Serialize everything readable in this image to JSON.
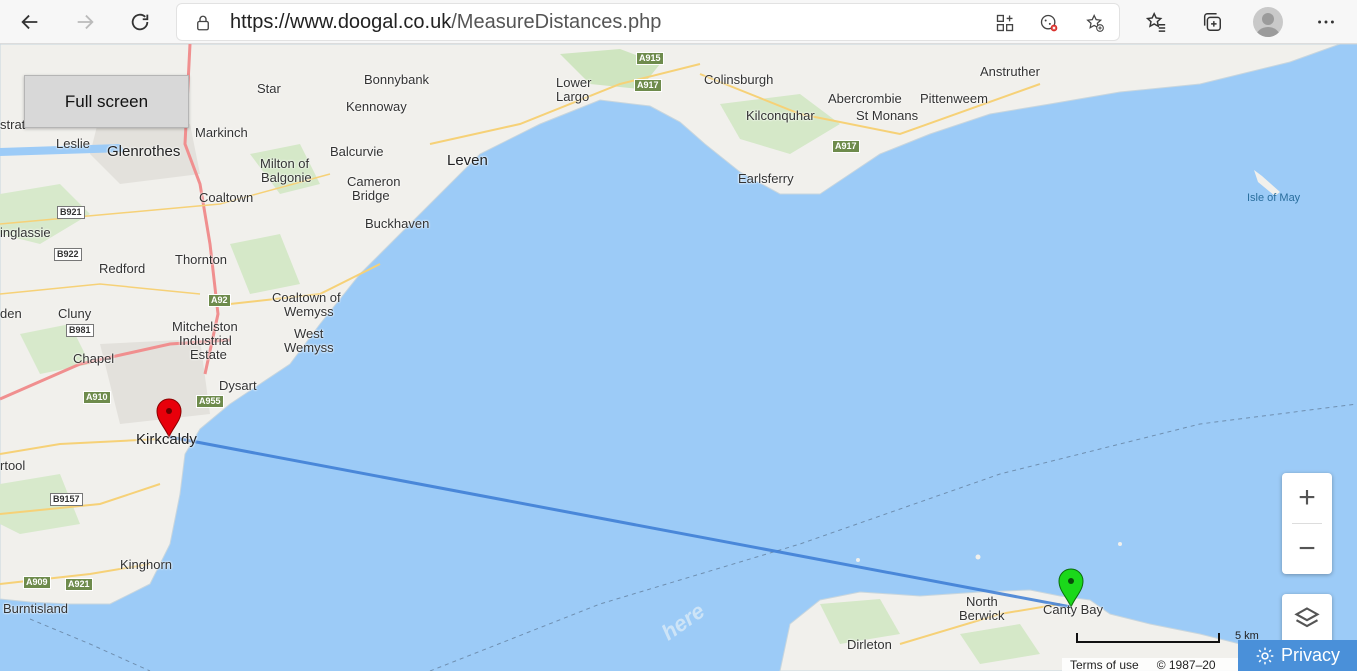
{
  "browser": {
    "url_host": "https://www.doogal.co.uk",
    "url_path": "/MeasureDistances.php"
  },
  "map": {
    "fullscreen_label": "Full screen",
    "zoom_in": "+",
    "zoom_out": "−",
    "scale_label": "5 km",
    "watermark": "here",
    "attribution": {
      "terms": "Terms of use",
      "copyright": "© 1987–20"
    },
    "privacy_label": "Privacy",
    "places": {
      "bonnybank": "Bonnybank",
      "star": "Star",
      "kennoway": "Kennoway",
      "lower_largo_1": "Lower",
      "lower_largo_2": "Largo",
      "colinsburgh": "Colinsburgh",
      "anstruther": "Anstruther",
      "kilconquhar": "Kilconquhar",
      "abercrombie": "Abercrombie",
      "pittenweem": "Pittenweem",
      "st_monans": "St Monans",
      "markinch": "Markinch",
      "leslie": "Leslie",
      "glenrothes": "Glenrothes",
      "milton_1": "Milton of",
      "milton_2": "Balgonie",
      "balcurvie": "Balcurvie",
      "leven": "Leven",
      "cameron_1": "Cameron",
      "cameron_2": "Bridge",
      "earlsferry": "Earlsferry",
      "coaltown": "Coaltown",
      "isle_of_may": "Isle of May",
      "buckhaven": "Buckhaven",
      "inglassie": "inglassie",
      "thornton": "Thornton",
      "redford": "Redford",
      "coaltown_wemyss_1": "Coaltown of",
      "coaltown_wemyss_2": "Wemyss",
      "west_wemyss_1": "West",
      "west_wemyss_2": "Wemyss",
      "cluny": "Cluny",
      "den": "den",
      "mitchelston_1": "Mitchelston",
      "mitchelston_2": "Industrial",
      "mitchelston_3": "Estate",
      "chapel": "Chapel",
      "dysart": "Dysart",
      "kirkcaldy": "Kirkcaldy",
      "rtool": "rtool",
      "kinghorn": "Kinghorn",
      "burntisland": "Burntisland",
      "strat": "strat",
      "north_berwick_1": "North",
      "north_berwick_2": "Berwick",
      "canty_bay": "Canty Bay",
      "dirleton": "Dirleton"
    },
    "roads": {
      "a915": "A915",
      "a917a": "A917",
      "a917b": "A917",
      "b921": "B921",
      "b922": "B922",
      "a92": "A92",
      "b981": "B981",
      "a910": "A910",
      "a955": "A955",
      "b9157": "B9157",
      "a909": "A909",
      "a921": "A921"
    },
    "markers": {
      "start_color": "#e8000b",
      "end_color": "#1bd81b",
      "line_color": "#3b7bd4"
    }
  }
}
